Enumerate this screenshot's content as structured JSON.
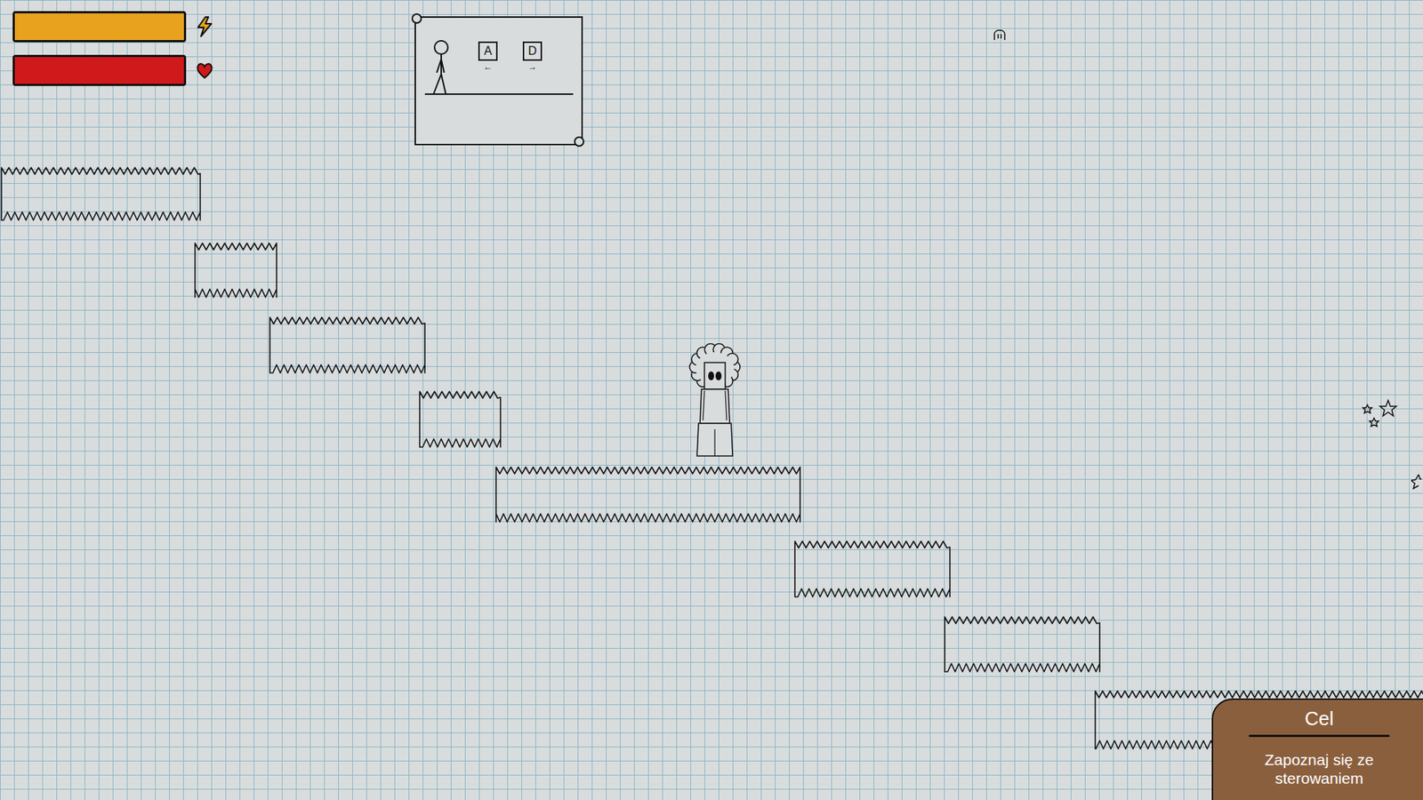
{
  "hud": {
    "bars": [
      {
        "kind": "energy",
        "level": 1,
        "color": "#e8a21e"
      },
      {
        "kind": "health",
        "level": 1,
        "color": "#d0191b"
      }
    ]
  },
  "tutorial_sign": {
    "keys": [
      {
        "label": "A",
        "arrow": "←"
      },
      {
        "label": "D",
        "arrow": "→"
      }
    ]
  },
  "objective": {
    "title": "Cel",
    "text": "Zapoznaj się ze sterowaniem"
  }
}
